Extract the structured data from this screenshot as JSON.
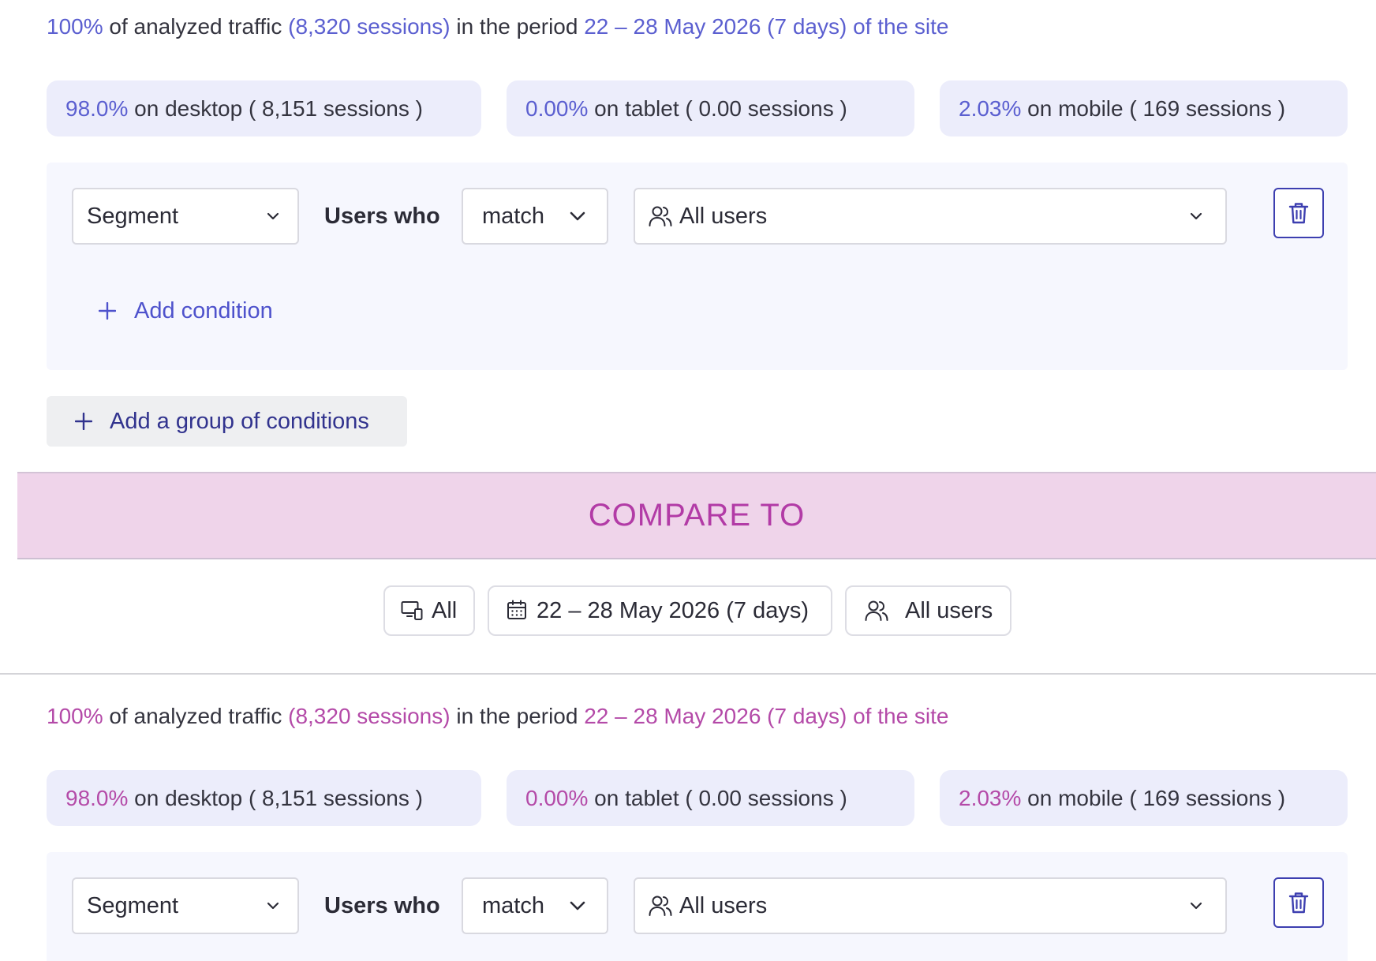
{
  "colors": {
    "accent_a": "#5b5fd0",
    "accent_b": "#b44aa8",
    "pill_bg": "#ecedfb",
    "compare_bg": "#efd4ea",
    "trash_border": "#3d3fb0"
  },
  "summary_a": {
    "pct": "100%",
    "text1": " of analyzed traffic ",
    "sessions": "(8,320 sessions)",
    "text2": " in the period ",
    "period": "22 – 28 May 2026 (7 days) of the site"
  },
  "devices_a": [
    {
      "pct": "98.0%",
      "label": " on desktop ( 8,151 sessions )"
    },
    {
      "pct": "0.00%",
      "label": " on tablet ( 0.00 sessions )"
    },
    {
      "pct": "2.03%",
      "label": " on mobile ( 169 sessions )"
    }
  ],
  "condition_a": {
    "segment_value": "Segment",
    "users_who_label": "Users who",
    "match_value": "match",
    "users_value": "All users",
    "add_condition_label": "Add condition"
  },
  "add_group_label": "Add a group of conditions",
  "compare_label": "COMPARE TO",
  "compare_filters": {
    "device": "All",
    "date": "22 – 28 May 2026 (7 days)",
    "users": "All users"
  },
  "summary_b": {
    "pct": "100%",
    "text1": " of analyzed traffic ",
    "sessions": "(8,320 sessions)",
    "text2": " in the period ",
    "period": "22 – 28 May 2026 (7 days) of the site"
  },
  "devices_b": [
    {
      "pct": "98.0%",
      "label": " on desktop ( 8,151 sessions )"
    },
    {
      "pct": "0.00%",
      "label": " on tablet ( 0.00 sessions )"
    },
    {
      "pct": "2.03%",
      "label": " on mobile ( 169 sessions )"
    }
  ],
  "condition_b": {
    "segment_value": "Segment",
    "users_who_label": "Users who",
    "match_value": "match",
    "users_value": "All users"
  },
  "icons": {
    "chevron": "chevron-down-icon",
    "users": "users-icon",
    "trash": "trash-icon",
    "plus": "plus-icon",
    "devices": "devices-icon",
    "calendar": "calendar-icon"
  }
}
